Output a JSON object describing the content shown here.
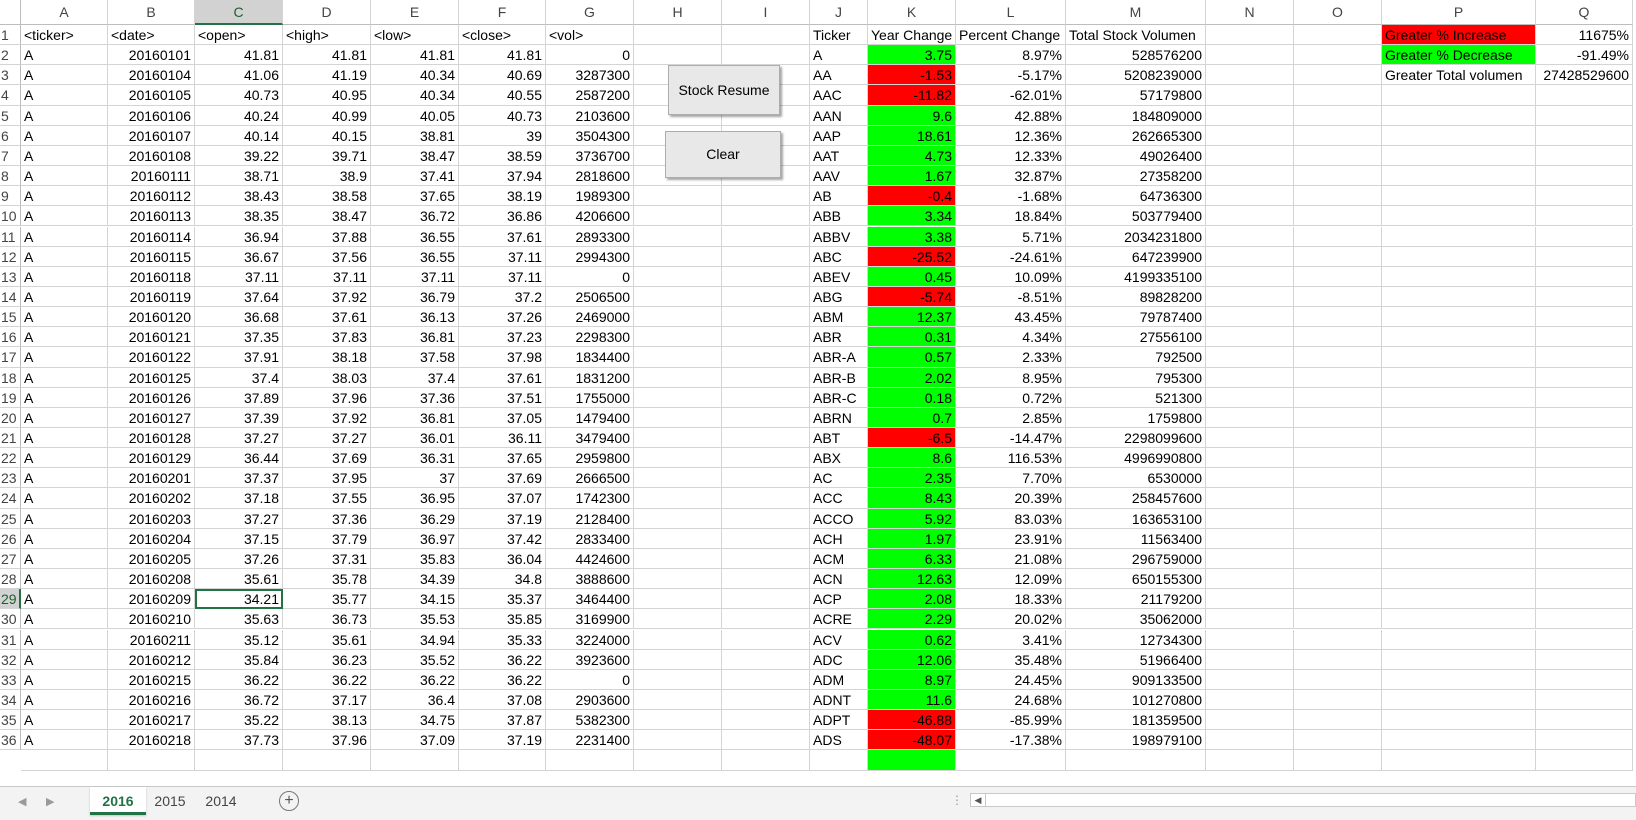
{
  "columns": [
    {
      "letter": "A",
      "w": 87
    },
    {
      "letter": "B",
      "w": 87
    },
    {
      "letter": "C",
      "w": 88
    },
    {
      "letter": "D",
      "w": 88
    },
    {
      "letter": "E",
      "w": 88
    },
    {
      "letter": "F",
      "w": 87
    },
    {
      "letter": "G",
      "w": 88
    },
    {
      "letter": "H",
      "w": 88
    },
    {
      "letter": "I",
      "w": 88
    },
    {
      "letter": "J",
      "w": 58
    },
    {
      "letter": "K",
      "w": 88
    },
    {
      "letter": "L",
      "w": 110
    },
    {
      "letter": "M",
      "w": 140
    },
    {
      "letter": "N",
      "w": 88
    },
    {
      "letter": "O",
      "w": 88
    },
    {
      "letter": "P",
      "w": 154
    },
    {
      "letter": "Q",
      "w": 97
    }
  ],
  "selected_column": "C",
  "selected_row": 29,
  "active_cell": "C29",
  "row_numbers": [
    "1",
    "2",
    "3",
    "4",
    "5",
    "6",
    "7",
    "8",
    "9",
    "10",
    "11",
    "12",
    "13",
    "14",
    "15",
    "16",
    "17",
    "18",
    "19",
    "20",
    "21",
    "22",
    "23",
    "24",
    "25",
    "26",
    "27",
    "28",
    "29",
    "30",
    "31",
    "32",
    "33",
    "34",
    "35",
    "36"
  ],
  "raw_data": {
    "headers": [
      "<ticker>",
      "<date>",
      "<open>",
      "<high>",
      "<low>",
      "<close>",
      "<vol>"
    ],
    "rows": [
      [
        "A",
        "20160101",
        "41.81",
        "41.81",
        "41.81",
        "41.81",
        "0"
      ],
      [
        "A",
        "20160104",
        "41.06",
        "41.19",
        "40.34",
        "40.69",
        "3287300"
      ],
      [
        "A",
        "20160105",
        "40.73",
        "40.95",
        "40.34",
        "40.55",
        "2587200"
      ],
      [
        "A",
        "20160106",
        "40.24",
        "40.99",
        "40.05",
        "40.73",
        "2103600"
      ],
      [
        "A",
        "20160107",
        "40.14",
        "40.15",
        "38.81",
        "39",
        "3504300"
      ],
      [
        "A",
        "20160108",
        "39.22",
        "39.71",
        "38.47",
        "38.59",
        "3736700"
      ],
      [
        "A",
        "20160111",
        "38.71",
        "38.9",
        "37.41",
        "37.94",
        "2818600"
      ],
      [
        "A",
        "20160112",
        "38.43",
        "38.58",
        "37.65",
        "38.19",
        "1989300"
      ],
      [
        "A",
        "20160113",
        "38.35",
        "38.47",
        "36.72",
        "36.86",
        "4206600"
      ],
      [
        "A",
        "20160114",
        "36.94",
        "37.88",
        "36.55",
        "37.61",
        "2893300"
      ],
      [
        "A",
        "20160115",
        "36.67",
        "37.56",
        "36.55",
        "37.11",
        "2994300"
      ],
      [
        "A",
        "20160118",
        "37.11",
        "37.11",
        "37.11",
        "37.11",
        "0"
      ],
      [
        "A",
        "20160119",
        "37.64",
        "37.92",
        "36.79",
        "37.2",
        "2506500"
      ],
      [
        "A",
        "20160120",
        "36.68",
        "37.61",
        "36.13",
        "37.26",
        "2469000"
      ],
      [
        "A",
        "20160121",
        "37.35",
        "37.83",
        "36.81",
        "37.23",
        "2298300"
      ],
      [
        "A",
        "20160122",
        "37.91",
        "38.18",
        "37.58",
        "37.98",
        "1834400"
      ],
      [
        "A",
        "20160125",
        "37.4",
        "38.03",
        "37.4",
        "37.61",
        "1831200"
      ],
      [
        "A",
        "20160126",
        "37.89",
        "37.96",
        "37.36",
        "37.51",
        "1755000"
      ],
      [
        "A",
        "20160127",
        "37.39",
        "37.92",
        "36.81",
        "37.05",
        "1479400"
      ],
      [
        "A",
        "20160128",
        "37.27",
        "37.27",
        "36.01",
        "36.11",
        "3479400"
      ],
      [
        "A",
        "20160129",
        "36.44",
        "37.69",
        "36.31",
        "37.65",
        "2959800"
      ],
      [
        "A",
        "20160201",
        "37.37",
        "37.95",
        "37",
        "37.69",
        "2666500"
      ],
      [
        "A",
        "20160202",
        "37.18",
        "37.55",
        "36.95",
        "37.07",
        "1742300"
      ],
      [
        "A",
        "20160203",
        "37.27",
        "37.36",
        "36.29",
        "37.19",
        "2128400"
      ],
      [
        "A",
        "20160204",
        "37.15",
        "37.79",
        "36.97",
        "37.42",
        "2833400"
      ],
      [
        "A",
        "20160205",
        "37.26",
        "37.31",
        "35.83",
        "36.04",
        "4424600"
      ],
      [
        "A",
        "20160208",
        "35.61",
        "35.78",
        "34.39",
        "34.8",
        "3888600"
      ],
      [
        "A",
        "20160209",
        "34.21",
        "35.77",
        "34.15",
        "35.37",
        "3464400"
      ],
      [
        "A",
        "20160210",
        "35.63",
        "36.73",
        "35.53",
        "35.85",
        "3169900"
      ],
      [
        "A",
        "20160211",
        "35.12",
        "35.61",
        "34.94",
        "35.33",
        "3224000"
      ],
      [
        "A",
        "20160212",
        "35.84",
        "36.23",
        "35.52",
        "36.22",
        "3923600"
      ],
      [
        "A",
        "20160215",
        "36.22",
        "36.22",
        "36.22",
        "36.22",
        "0"
      ],
      [
        "A",
        "20160216",
        "36.72",
        "37.17",
        "36.4",
        "37.08",
        "2903600"
      ],
      [
        "A",
        "20160217",
        "35.22",
        "38.13",
        "34.75",
        "37.87",
        "5382300"
      ],
      [
        "A",
        "20160218",
        "37.73",
        "37.96",
        "37.09",
        "37.19",
        "2231400"
      ]
    ]
  },
  "buttons": {
    "stock_resume": "Stock Resume",
    "clear": "Clear"
  },
  "summary": {
    "headers": [
      "Ticker",
      "Year Change",
      "Percent Change",
      "Total Stock Volumen"
    ],
    "rows": [
      {
        "ticker": "A",
        "change": "3.75",
        "pct": "8.97%",
        "vol": "528576200",
        "status": "pos"
      },
      {
        "ticker": "AA",
        "change": "-1.53",
        "pct": "-5.17%",
        "vol": "5208239000",
        "status": "neg"
      },
      {
        "ticker": "AAC",
        "change": "-11.82",
        "pct": "-62.01%",
        "vol": "57179800",
        "status": "neg"
      },
      {
        "ticker": "AAN",
        "change": "9.6",
        "pct": "42.88%",
        "vol": "184809000",
        "status": "pos"
      },
      {
        "ticker": "AAP",
        "change": "18.61",
        "pct": "12.36%",
        "vol": "262665300",
        "status": "pos"
      },
      {
        "ticker": "AAT",
        "change": "4.73",
        "pct": "12.33%",
        "vol": "49026400",
        "status": "pos"
      },
      {
        "ticker": "AAV",
        "change": "1.67",
        "pct": "32.87%",
        "vol": "27358200",
        "status": "pos"
      },
      {
        "ticker": "AB",
        "change": "-0.4",
        "pct": "-1.68%",
        "vol": "64736300",
        "status": "neg"
      },
      {
        "ticker": "ABB",
        "change": "3.34",
        "pct": "18.84%",
        "vol": "503779400",
        "status": "pos"
      },
      {
        "ticker": "ABBV",
        "change": "3.38",
        "pct": "5.71%",
        "vol": "2034231800",
        "status": "pos"
      },
      {
        "ticker": "ABC",
        "change": "-25.52",
        "pct": "-24.61%",
        "vol": "647239900",
        "status": "neg"
      },
      {
        "ticker": "ABEV",
        "change": "0.45",
        "pct": "10.09%",
        "vol": "4199335100",
        "status": "pos"
      },
      {
        "ticker": "ABG",
        "change": "-5.74",
        "pct": "-8.51%",
        "vol": "89828200",
        "status": "neg"
      },
      {
        "ticker": "ABM",
        "change": "12.37",
        "pct": "43.45%",
        "vol": "79787400",
        "status": "pos"
      },
      {
        "ticker": "ABR",
        "change": "0.31",
        "pct": "4.34%",
        "vol": "27556100",
        "status": "pos"
      },
      {
        "ticker": "ABR-A",
        "change": "0.57",
        "pct": "2.33%",
        "vol": "792500",
        "status": "pos"
      },
      {
        "ticker": "ABR-B",
        "change": "2.02",
        "pct": "8.95%",
        "vol": "795300",
        "status": "pos"
      },
      {
        "ticker": "ABR-C",
        "change": "0.18",
        "pct": "0.72%",
        "vol": "521300",
        "status": "pos"
      },
      {
        "ticker": "ABRN",
        "change": "0.7",
        "pct": "2.85%",
        "vol": "1759800",
        "status": "pos"
      },
      {
        "ticker": "ABT",
        "change": "-6.5",
        "pct": "-14.47%",
        "vol": "2298099600",
        "status": "neg"
      },
      {
        "ticker": "ABX",
        "change": "8.6",
        "pct": "116.53%",
        "vol": "4996990800",
        "status": "pos"
      },
      {
        "ticker": "AC",
        "change": "2.35",
        "pct": "7.70%",
        "vol": "6530000",
        "status": "pos"
      },
      {
        "ticker": "ACC",
        "change": "8.43",
        "pct": "20.39%",
        "vol": "258457600",
        "status": "pos"
      },
      {
        "ticker": "ACCO",
        "change": "5.92",
        "pct": "83.03%",
        "vol": "163653100",
        "status": "pos"
      },
      {
        "ticker": "ACH",
        "change": "1.97",
        "pct": "23.91%",
        "vol": "11563400",
        "status": "pos"
      },
      {
        "ticker": "ACM",
        "change": "6.33",
        "pct": "21.08%",
        "vol": "296759000",
        "status": "pos"
      },
      {
        "ticker": "ACN",
        "change": "12.63",
        "pct": "12.09%",
        "vol": "650155300",
        "status": "pos"
      },
      {
        "ticker": "ACP",
        "change": "2.08",
        "pct": "18.33%",
        "vol": "21179200",
        "status": "pos"
      },
      {
        "ticker": "ACRE",
        "change": "2.29",
        "pct": "20.02%",
        "vol": "35062000",
        "status": "pos"
      },
      {
        "ticker": "ACV",
        "change": "0.62",
        "pct": "3.41%",
        "vol": "12734300",
        "status": "pos"
      },
      {
        "ticker": "ADC",
        "change": "12.06",
        "pct": "35.48%",
        "vol": "51966400",
        "status": "pos"
      },
      {
        "ticker": "ADM",
        "change": "8.97",
        "pct": "24.45%",
        "vol": "909133500",
        "status": "pos"
      },
      {
        "ticker": "ADNT",
        "change": "11.6",
        "pct": "24.68%",
        "vol": "101270800",
        "status": "pos"
      },
      {
        "ticker": "ADPT",
        "change": "-46.88",
        "pct": "-85.99%",
        "vol": "181359500",
        "status": "neg"
      },
      {
        "ticker": "ADS",
        "change": "-48.07",
        "pct": "-17.38%",
        "vol": "198979100",
        "status": "neg"
      }
    ]
  },
  "greatest": [
    {
      "label": "Greater % Increase",
      "value": "11675%",
      "color": "red"
    },
    {
      "label": "Greater % Decrease",
      "value": "-91.49%",
      "color": "green"
    },
    {
      "label": "Greater Total volumen",
      "value": "27428529600",
      "color": ""
    }
  ],
  "colors": {
    "positive": "#00ff00",
    "negative": "#ff0000",
    "accent": "#217346"
  },
  "sheet_tabs": [
    {
      "name": "2016",
      "active": true
    },
    {
      "name": "2015",
      "active": false
    },
    {
      "name": "2014",
      "active": false
    }
  ],
  "icons": {
    "nav_prev": "triangle-left-icon",
    "nav_next": "triangle-right-icon",
    "add_sheet": "plus-circle-icon",
    "scroll_left": "triangle-left-icon"
  }
}
